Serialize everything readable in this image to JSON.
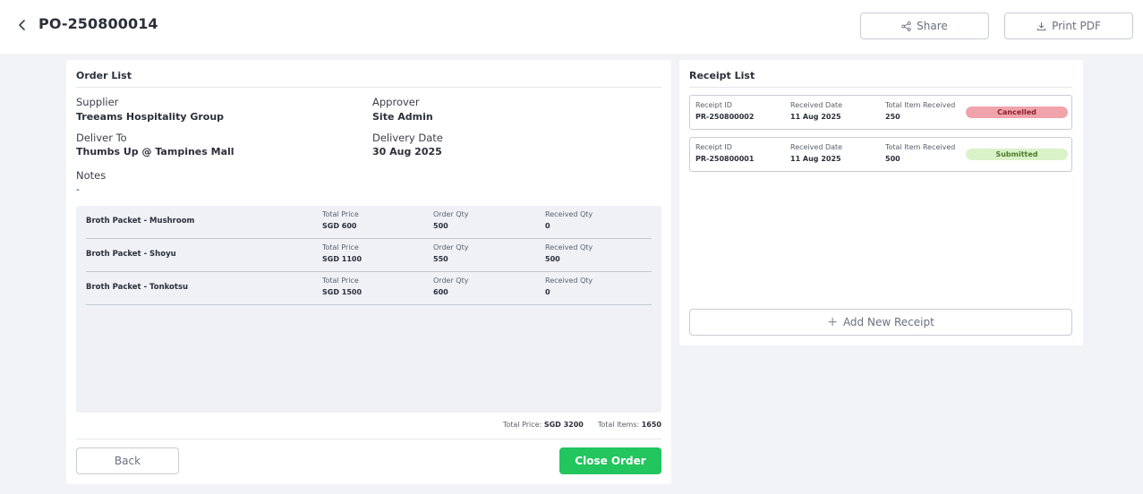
{
  "header": {
    "title": "PO-250800014",
    "share_label": "Share",
    "print_label": "Print PDF"
  },
  "order_list": {
    "title": "Order List",
    "supplier_label": "Supplier",
    "supplier_value": "Treeams Hospitality Group",
    "approver_label": "Approver",
    "approver_value": "Site Admin",
    "deliver_to_label": "Deliver To",
    "deliver_to_value": "Thumbs Up @ Tampines Mall",
    "delivery_date_label": "Delivery Date",
    "delivery_date_value": "30 Aug 2025",
    "notes_label": "Notes",
    "notes_value": "-",
    "column_labels": {
      "total_price": "Total Price",
      "order_qty": "Order Qty",
      "received_qty": "Received Qty"
    },
    "items": [
      {
        "name": "Broth Packet - Mushroom",
        "total_price": "SGD 600",
        "order_qty": "500",
        "received_qty": "0"
      },
      {
        "name": "Broth Packet - Shoyu",
        "total_price": "SGD 1100",
        "order_qty": "550",
        "received_qty": "500"
      },
      {
        "name": "Broth Packet - Tonkotsu",
        "total_price": "SGD 1500",
        "order_qty": "600",
        "received_qty": "0"
      }
    ],
    "total_price_label": "Total Price:",
    "total_price_value": "SGD 3200",
    "total_items_label": "Total Items:",
    "total_items_value": "1650",
    "back_label": "Back",
    "close_label": "Close Order"
  },
  "receipt_list": {
    "title": "Receipt List",
    "column_labels": {
      "receipt_id": "Receipt ID",
      "received_date": "Received Date",
      "total_received": "Total Item Received"
    },
    "receipts": [
      {
        "id": "PR-250800002",
        "date": "11 Aug 2025",
        "total": "250",
        "status": "Cancelled",
        "status_bg": "#f0a3ab",
        "status_fg": "#8a1f2b"
      },
      {
        "id": "PR-250800001",
        "date": "11 Aug 2025",
        "total": "500",
        "status": "Submitted",
        "status_bg": "#d9f2c8",
        "status_fg": "#4d7a2e"
      }
    ],
    "add_label": "Add New Receipt"
  },
  "colors": {
    "accent_green": "#22c55e",
    "page_bg": "#f1f3f7"
  },
  "icons": {
    "back": "chevron-left-icon",
    "share": "share-icon",
    "print": "download-icon",
    "add": "plus-icon"
  }
}
